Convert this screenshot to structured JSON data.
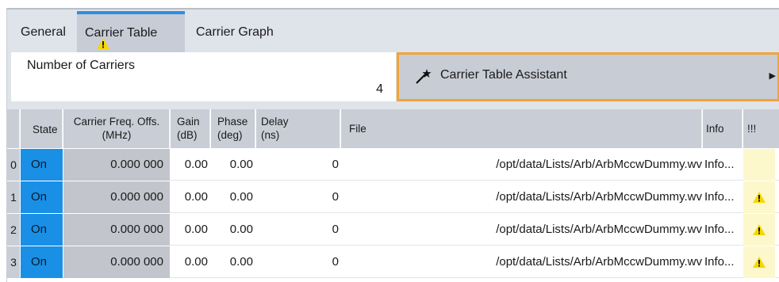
{
  "tabs": [
    {
      "label": "General"
    },
    {
      "label": "Carrier Table"
    },
    {
      "label": "Carrier Graph"
    }
  ],
  "num_carriers": {
    "label": "Number of Carriers",
    "value": "4"
  },
  "assistant": {
    "label": "Carrier Table Assistant",
    "icon": "magic-wand-icon",
    "arrow": "▶"
  },
  "table": {
    "headers": {
      "state": "State",
      "freq_line1": "Carrier Freq. Offs.",
      "freq_line2": "(MHz)",
      "gain_line1": "Gain",
      "gain_line2": "(dB)",
      "phase_line1": "Phase",
      "phase_line2": "(deg)",
      "delay_line1": "Delay",
      "delay_line2": "(ns)",
      "file": "File",
      "info": "Info",
      "warn": "!!!"
    },
    "rows": [
      {
        "index": "0",
        "state": "On",
        "freq": "0.000 000",
        "gain": "0.00",
        "phase": "0.00",
        "delay": "0",
        "file": "/opt/data/Lists/Arb/ArbMccwDummy.wv",
        "info": "Info...",
        "warning": false
      },
      {
        "index": "1",
        "state": "On",
        "freq": "0.000 000",
        "gain": "0.00",
        "phase": "0.00",
        "delay": "0",
        "file": "/opt/data/Lists/Arb/ArbMccwDummy.wv",
        "info": "Info...",
        "warning": true
      },
      {
        "index": "2",
        "state": "On",
        "freq": "0.000 000",
        "gain": "0.00",
        "phase": "0.00",
        "delay": "0",
        "file": "/opt/data/Lists/Arb/ArbMccwDummy.wv",
        "info": "Info...",
        "warning": true
      },
      {
        "index": "3",
        "state": "On",
        "freq": "0.000 000",
        "gain": "0.00",
        "phase": "0.00",
        "delay": "0",
        "file": "/opt/data/Lists/Arb/ArbMccwDummy.wv",
        "info": "Info...",
        "warning": true
      }
    ]
  },
  "colors": {
    "active_tab_accent": "#2f8fe0",
    "state_on": "#1a8fe6",
    "assistant_border": "#f0a436",
    "warning_yellow": "#f5d800",
    "warning_column_bg": "#fdf7cc"
  }
}
